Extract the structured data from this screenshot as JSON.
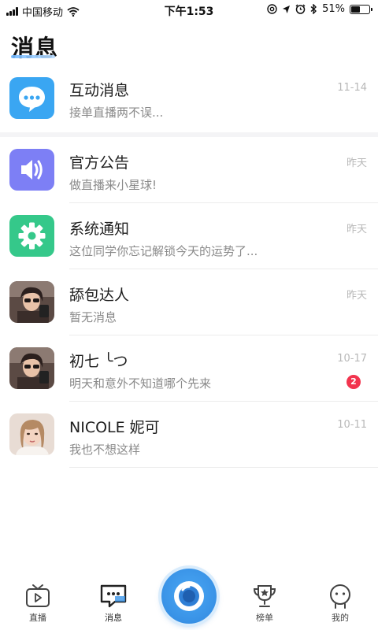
{
  "status_bar": {
    "carrier": "中国移动",
    "time": "下午1:53",
    "battery": "51%",
    "battery_level": 0.51,
    "icons": [
      "signal-icon",
      "wifi-icon",
      "at-icon",
      "location-icon",
      "alarm-icon",
      "bluetooth-icon",
      "battery-icon"
    ]
  },
  "page": {
    "title": "消息"
  },
  "messages": [
    {
      "title": "互动消息",
      "preview": "接单直播两不误...",
      "time": "11-14",
      "icon": "chat-bubble-icon",
      "color": "#3aa6f2"
    },
    {
      "title": "官方公告",
      "preview": "做直播来小星球!",
      "time": "昨天",
      "icon": "speaker-icon",
      "color": "#7d7ff5"
    },
    {
      "title": "系统通知",
      "preview": "这位同学你忘记解锁今天的运势了...",
      "time": "昨天",
      "icon": "gear-icon",
      "color": "#35c88a"
    },
    {
      "title": "舔包达人",
      "preview": "暂无消息",
      "time": "昨天",
      "icon": "user-avatar"
    },
    {
      "title": "初七 ╰つ",
      "preview": "明天和意外不知道哪个先来",
      "time": "10-17",
      "icon": "user-avatar",
      "badge": "2"
    },
    {
      "title": "NICOLE 妮可",
      "preview": "我也不想这样",
      "time": "10-11",
      "icon": "user-avatar"
    }
  ],
  "tab_bar": {
    "tabs": [
      {
        "label": "直播",
        "icon": "tv-icon"
      },
      {
        "label": "消息",
        "icon": "message-icon",
        "active": true
      },
      {
        "label": "",
        "icon": "camera-lens-icon"
      },
      {
        "label": "榜单",
        "icon": "trophy-icon"
      },
      {
        "label": "我的",
        "icon": "profile-icon"
      }
    ]
  }
}
